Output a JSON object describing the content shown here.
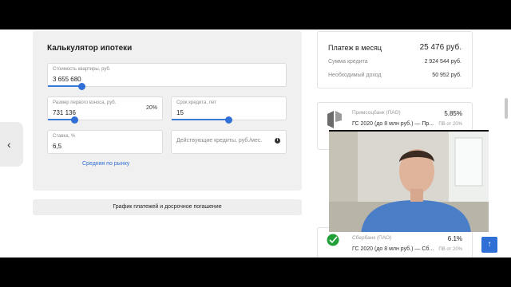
{
  "calculator": {
    "title": "Калькулятор ипотеки",
    "property_cost": {
      "label": "Стоимость квартиры, руб.",
      "value": "3 655 680"
    },
    "down_payment": {
      "label": "Размер первого взноса, руб.",
      "value": "731 136",
      "percent": "20%"
    },
    "term": {
      "label": "Срок кредита, лет",
      "value": "15"
    },
    "rate": {
      "label": "Ставка, %",
      "value": "6,5"
    },
    "existing_credits": {
      "placeholder": "Действующие кредиты, руб./мес."
    },
    "info_symbol": "i",
    "average_link": "Средняя по рынку"
  },
  "schedule_button": "График платежей и досрочное погашение",
  "nav": {
    "prev_arrow": "‹"
  },
  "summary": {
    "title": "Платеж в месяц",
    "monthly_payment": "25 476 руб.",
    "loan_amount_label": "Сумма кредита",
    "loan_amount": "2 924 544 руб.",
    "income_label": "Необходимый доход",
    "income": "50 952 руб."
  },
  "offers": [
    {
      "bank": "Примсоцбанк (ПАО)",
      "rate": "5.85%",
      "program": "ГС 2020 (до 8 млн руб.) — Пр...",
      "pv": "ПВ от 20%",
      "logo_color": "#6b6b6b"
    },
    {
      "bank": "Сбербанк (ПАО)",
      "rate": "6.1%",
      "program": "ГС 2020 (до 8 млн руб.) — Сб...",
      "pv": "ПВ от 20%",
      "logo_color": "#21a038"
    }
  ],
  "scroll_top_icon": "↑",
  "colors": {
    "accent": "#2f6fd6",
    "panel": "#f0f0f0",
    "sber": "#21a038"
  }
}
